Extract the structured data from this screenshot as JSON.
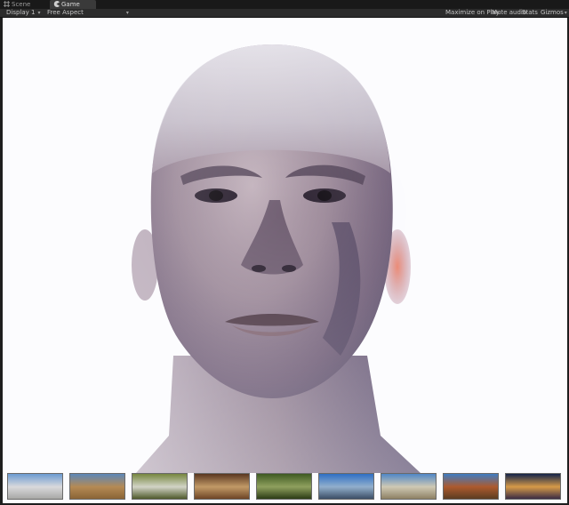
{
  "tabs": [
    {
      "label": "Scene",
      "icon": "scene-grid-icon"
    },
    {
      "label": "Game",
      "icon": "game-pacman-icon",
      "active": true
    }
  ],
  "toolbar": {
    "display": "Display 1",
    "aspect": "Free Aspect",
    "maximize": "Maximize on Play",
    "mute": "Mute audio",
    "stats": "Stats",
    "gizmos": "Gizmos"
  },
  "environments": [
    {
      "name": "hdri-1",
      "sky": "#6b9ad1",
      "mid": "#d9d9dc",
      "ground": "#a8a8a6"
    },
    {
      "name": "hdri-2",
      "sky": "#5c87b8",
      "mid": "#b58a54",
      "ground": "#8a6436"
    },
    {
      "name": "hdri-3",
      "sky": "#76863f",
      "mid": "#d2d4c6",
      "ground": "#4f5a2c"
    },
    {
      "name": "hdri-4",
      "sky": "#5a3720",
      "mid": "#c29a67",
      "ground": "#6e4526"
    },
    {
      "name": "hdri-5",
      "sky": "#3e5a22",
      "mid": "#8fa05e",
      "ground": "#2c3c16"
    },
    {
      "name": "hdri-6",
      "sky": "#2f6fc4",
      "mid": "#92afcc",
      "ground": "#3c4e66"
    },
    {
      "name": "hdri-7",
      "sky": "#4f86c6",
      "mid": "#cfc9b4",
      "ground": "#8e8164"
    },
    {
      "name": "hdri-8",
      "sky": "#3f7cc2",
      "mid": "#ad5a2e",
      "ground": "#5c3d22"
    },
    {
      "name": "hdri-9",
      "sky": "#14244a",
      "mid": "#d69a48",
      "ground": "#3a2c44"
    }
  ]
}
